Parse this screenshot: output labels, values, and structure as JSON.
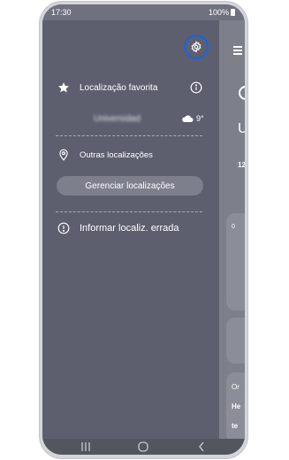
{
  "status_bar": {
    "time": "17:30",
    "battery": "100%"
  },
  "drawer": {
    "settings_icon": "gear-icon",
    "favorite": {
      "label": "Localização favorita",
      "icon": "star-icon",
      "info_icon": "info-icon"
    },
    "favorite_location": {
      "name": "Universidad",
      "weather_icon": "cloud-icon",
      "temperature": "9°"
    },
    "other_locations": {
      "label": "Outras localizações",
      "icon": "location-pin-icon"
    },
    "manage_button": "Gerenciar localizações",
    "report": {
      "label": "Informar localiz. errada",
      "icon": "alert-icon"
    }
  },
  "background": {
    "heading_letter": "U",
    "time_fragment": "12",
    "card_texts": [
      "0",
      "Or",
      "He",
      "te"
    ]
  },
  "colors": {
    "drawer_bg": "#5d5f6f",
    "highlight": "#1763e6",
    "button_bg": "#7d7f8d"
  }
}
